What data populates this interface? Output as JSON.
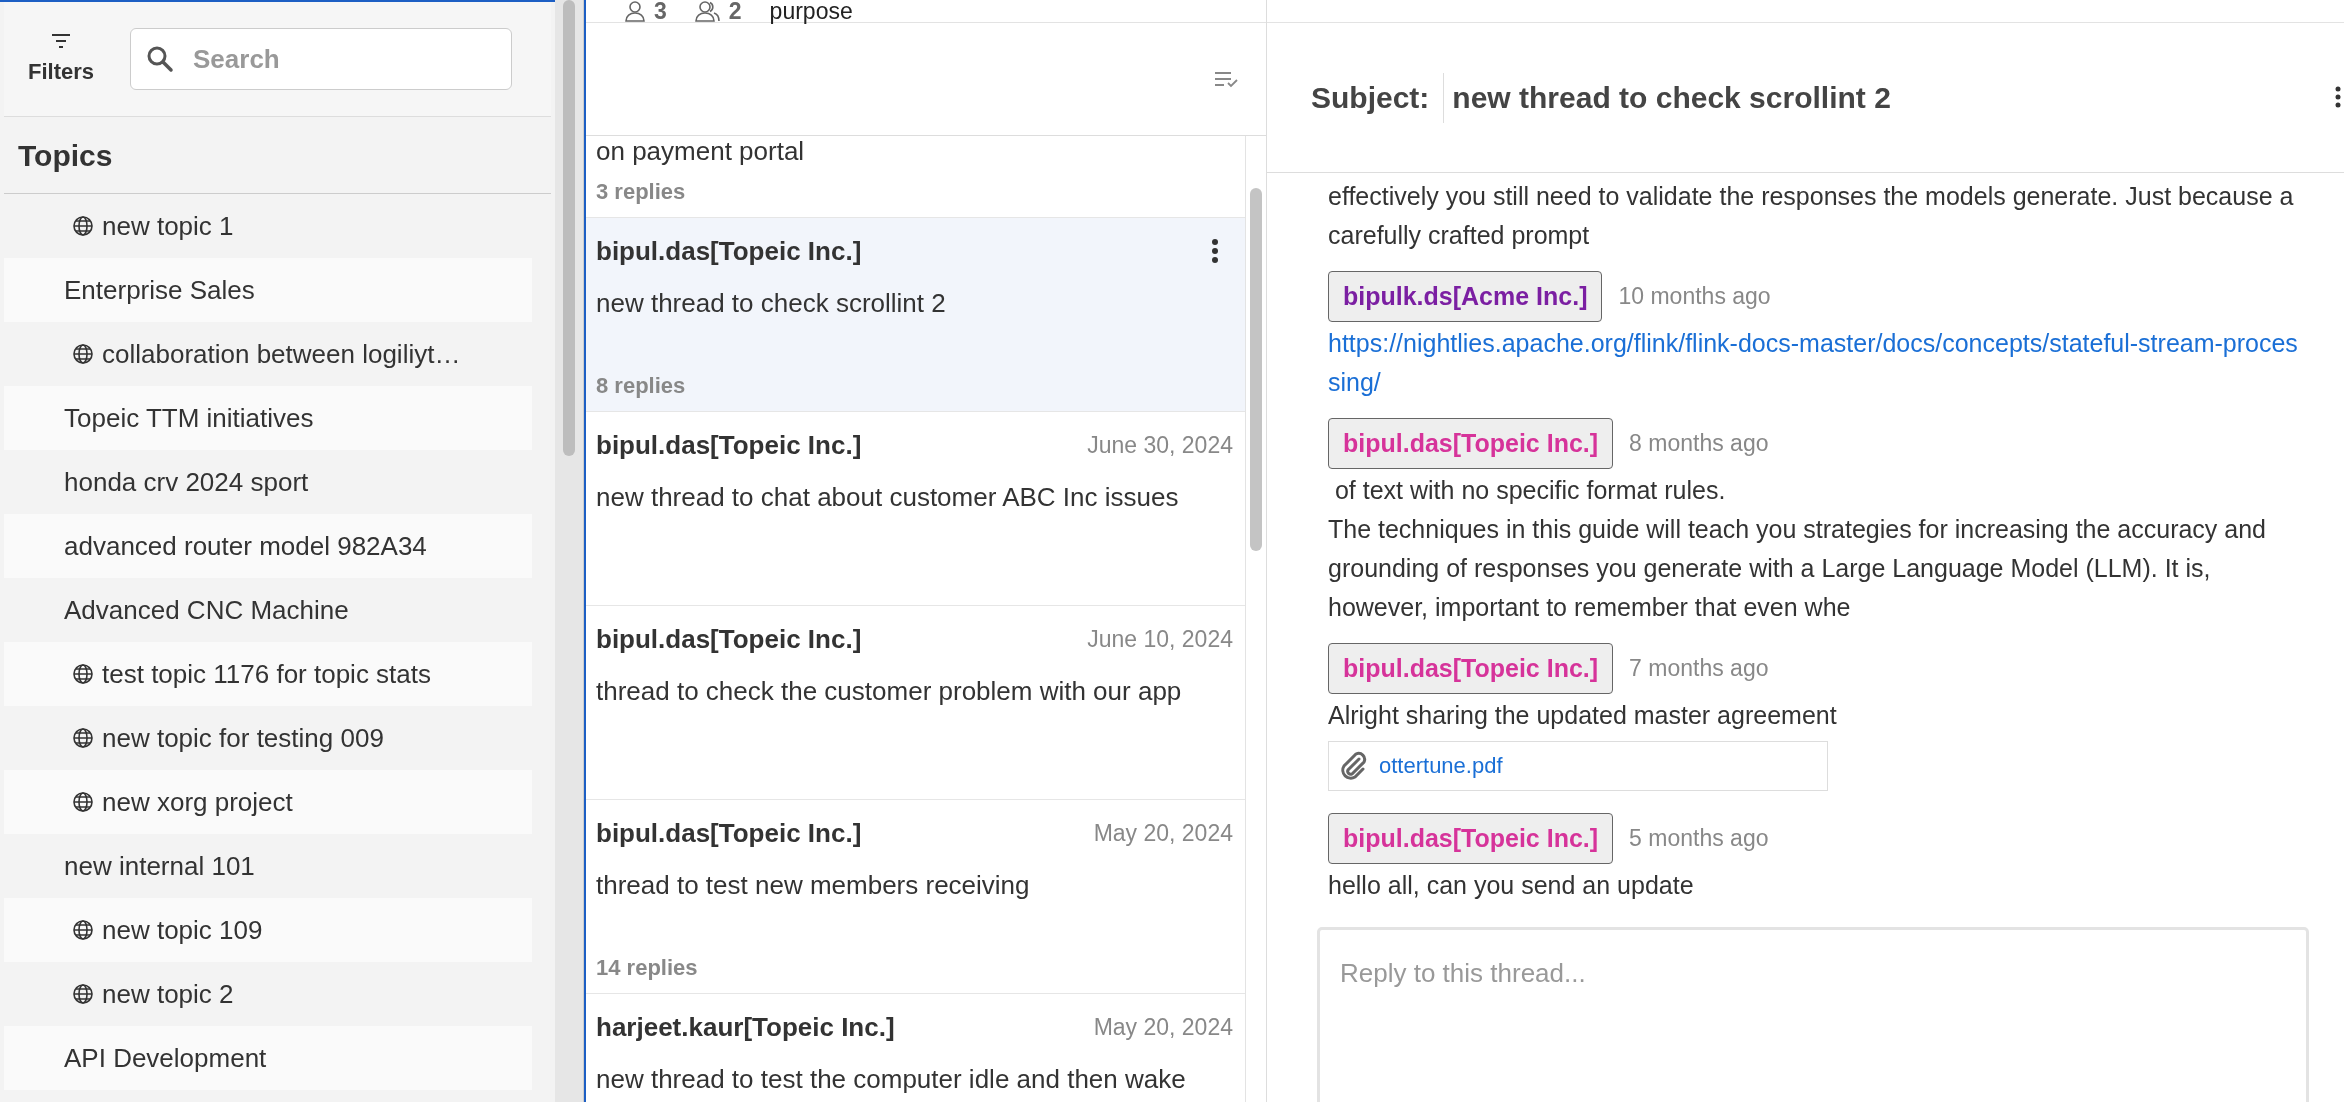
{
  "sidebar": {
    "filters_label": "Filters",
    "search": {
      "placeholder": "Search"
    },
    "heading": "Topics",
    "items": [
      {
        "label": "new topic 1",
        "public": true
      },
      {
        "label": "Enterprise Sales",
        "public": false
      },
      {
        "label": "collaboration between logiliyt…",
        "public": true
      },
      {
        "label": "Topeic TTM initiatives",
        "public": false
      },
      {
        "label": "honda crv 2024 sport",
        "public": false
      },
      {
        "label": "advanced router model 982A34",
        "public": false
      },
      {
        "label": "Advanced CNC Machine",
        "public": false
      },
      {
        "label": "test topic 1176 for topic stats",
        "public": true
      },
      {
        "label": "new topic for testing 009",
        "public": true
      },
      {
        "label": "new xorg project",
        "public": true
      },
      {
        "label": "new internal 101",
        "public": false
      },
      {
        "label": "new topic 109",
        "public": true
      },
      {
        "label": "new topic 2",
        "public": true
      },
      {
        "label": "API Development",
        "public": false
      }
    ]
  },
  "topic_stats": {
    "members": "3",
    "groups": "2",
    "purpose": "purpose"
  },
  "threads": [
    {
      "body": "on payment portal",
      "replies": "3 replies",
      "selected": false
    },
    {
      "author": "bipul.das[Topeic Inc.]",
      "body": "new thread to check scrollint 2",
      "replies": "8 replies",
      "selected": true
    },
    {
      "author": "bipul.das[Topeic Inc.]",
      "date": "June 30, 2024",
      "body": "new thread to chat about customer ABC Inc issues",
      "selected": false
    },
    {
      "author": "bipul.das[Topeic Inc.]",
      "date": "June 10, 2024",
      "body": "thread to check the customer problem with our app",
      "selected": false
    },
    {
      "author": "bipul.das[Topeic Inc.]",
      "date": "May 20, 2024",
      "body": "thread to test new members receiving",
      "replies": "14 replies",
      "selected": false
    },
    {
      "author": "harjeet.kaur[Topeic Inc.]",
      "date": "May 20, 2024",
      "body": "new thread to test the computer idle and then wake",
      "selected": false
    }
  ],
  "thread_view": {
    "subject_label": "Subject:",
    "subject": "new thread to check scrollint 2",
    "messages": [
      {
        "parts": [
          {
            "kind": "text",
            "text": "effectively you still need to validate the responses the models generate. Just because a carefully crafted prompt"
          }
        ]
      },
      {
        "author": "bipulk.ds[Acme Inc.]",
        "color": "#7b1fa2",
        "time": "10 months ago",
        "parts": [
          {
            "kind": "link",
            "text": "https://nightlies.apache.org/flink/flink-docs-master/docs/concepts/stateful-stream-processing/"
          }
        ]
      },
      {
        "author": "bipul.das[Topeic Inc.]",
        "color": "#d6339a",
        "time": "8 months ago",
        "parts": [
          {
            "kind": "text",
            "text": " of text with no specific format rules."
          },
          {
            "kind": "text",
            "text": "The techniques in this guide will teach you strategies for increasing the accuracy and grounding of responses you generate with a Large Language Model (LLM). It is, however, important to remember that even whe"
          }
        ]
      },
      {
        "author": "bipul.das[Topeic Inc.]",
        "color": "#d6339a",
        "time": "7 months ago",
        "parts": [
          {
            "kind": "text",
            "text": "Alright sharing the updated master agreement"
          },
          {
            "kind": "attachment",
            "text": "ottertune.pdf"
          }
        ]
      },
      {
        "author": "bipul.das[Topeic Inc.]",
        "color": "#d6339a",
        "time": "5 months ago",
        "parts": [
          {
            "kind": "text",
            "text": "hello all, can you send an update"
          }
        ]
      }
    ],
    "reply": {
      "placeholder": "Reply to this thread..."
    }
  }
}
